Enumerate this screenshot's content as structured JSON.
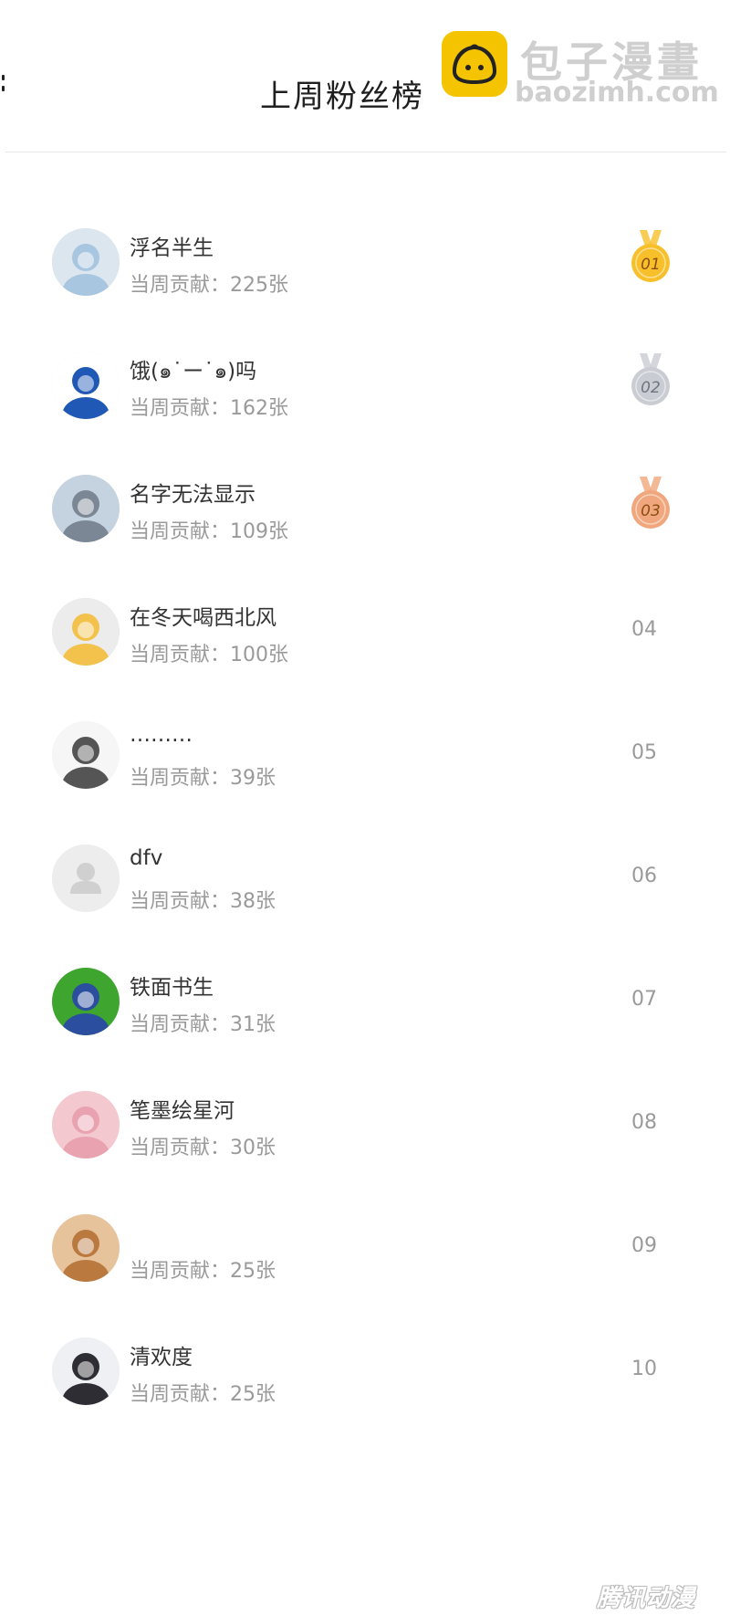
{
  "header": {
    "title": "上周粉丝榜"
  },
  "watermark": {
    "brand": "包子漫畫",
    "url": "baozimh.com"
  },
  "footer_watermark": "腾讯动漫",
  "colors": {
    "gold": "#f7c02b",
    "silver": "#c9ccd2",
    "bronze": "#f0a77d",
    "muted": "#9a9a9a"
  },
  "rows": [
    {
      "name": "浮名半生",
      "contribution": "当周贡献：225张",
      "rank": "01",
      "medal": "gold",
      "avatar_icon": "anime-boy-avatar-icon",
      "avatar_bg": "#dbe6ee",
      "avatar_fg": "#a8c6df"
    },
    {
      "name": "饿(๑˙ー˙๑)吗",
      "contribution": "当周贡献：162张",
      "rank": "02",
      "medal": "silver",
      "avatar_icon": "delivery-rider-avatar-icon",
      "avatar_bg": "#ffffff",
      "avatar_fg": "#1f58b5"
    },
    {
      "name": "名字无法显示",
      "contribution": "当周贡献：109张",
      "rank": "03",
      "medal": "bronze",
      "avatar_icon": "seaside-person-avatar-icon",
      "avatar_bg": "#c5d2df",
      "avatar_fg": "#7b8794"
    },
    {
      "name": "在冬天喝西北风",
      "contribution": "当周贡献：100张",
      "rank": "04",
      "medal": "",
      "avatar_icon": "flower-avatar-icon",
      "avatar_bg": "#ececec",
      "avatar_fg": "#f2c24c"
    },
    {
      "name": "………",
      "contribution": "当周贡献：39张",
      "rank": "05",
      "medal": "",
      "avatar_icon": "sketch-character-avatar-icon",
      "avatar_bg": "#f6f6f6",
      "avatar_fg": "#555555"
    },
    {
      "name": "dfv",
      "contribution": "当周贡献：38张",
      "rank": "06",
      "medal": "",
      "avatar_icon": "default-user-avatar-icon",
      "avatar_bg": "#ededed",
      "avatar_fg": "#d0d0d0"
    },
    {
      "name": "铁面书生",
      "contribution": "当周贡献：31张",
      "rank": "07",
      "medal": "",
      "avatar_icon": "frog-hood-avatar-icon",
      "avatar_bg": "#3ea52f",
      "avatar_fg": "#2b4f9e"
    },
    {
      "name": "笔墨绘星河",
      "contribution": "当周贡献：30张",
      "rank": "08",
      "medal": "",
      "avatar_icon": "pink-hair-girl-avatar-icon",
      "avatar_bg": "#f3c9cf",
      "avatar_fg": "#e9a3b0"
    },
    {
      "name": "",
      "contribution": "当周贡献：25张",
      "rank": "09",
      "medal": "",
      "avatar_icon": "shiba-dog-avatar-icon",
      "avatar_bg": "#e7c39b",
      "avatar_fg": "#b9793f"
    },
    {
      "name": "清欢度",
      "contribution": "当周贡献：25张",
      "rank": "10",
      "medal": "",
      "avatar_icon": "dark-hair-girl-avatar-icon",
      "avatar_bg": "#eef0f4",
      "avatar_fg": "#2d2d33"
    }
  ]
}
